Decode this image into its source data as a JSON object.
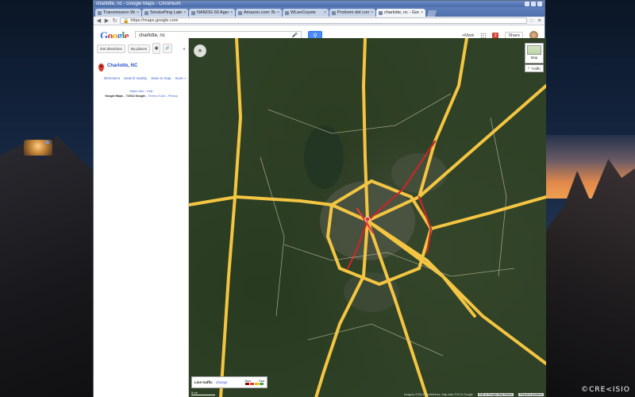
{
  "window": {
    "title": "charlotte, nc - Google Maps - Chromium"
  },
  "tabs": [
    {
      "label": "Transmission Web Inter",
      "active": false
    },
    {
      "label": "SmokePing Latency Pa",
      "active": false
    },
    {
      "label": "NANOG 60 Agenda | N",
      "active": false
    },
    {
      "label": "Amazon.com: Balance",
      "active": false
    },
    {
      "label": "WLeeCoyote",
      "active": false
    },
    {
      "label": "Proloom dot com: Unc",
      "active": false
    },
    {
      "label": "charlotte, nc - Google",
      "active": true
    }
  ],
  "toolbar": {
    "back_icon": "back-arrow-icon",
    "forward_icon": "forward-arrow-icon",
    "reload_icon": "reload-icon",
    "url": "https://maps.google.com"
  },
  "google_header": {
    "logo_letters": [
      "G",
      "o",
      "o",
      "g",
      "l",
      "e"
    ],
    "search_value": "charlotte, nc",
    "user_label": "+Mark",
    "notif_count": "2",
    "share_label": "Share"
  },
  "left_panel": {
    "get_directions_label": "Get directions",
    "my_places_label": "My places",
    "print_label": "🖶",
    "link_icon_label": "🔗",
    "result": {
      "title": "Charlotte, NC",
      "links": [
        "Directions",
        "Search nearby",
        "Save to map",
        "more »"
      ]
    },
    "footer": {
      "line1_a": "Maps Labs",
      "line1_b": "Help",
      "line2_a": "Google Maps",
      "line2_b": "©2014 Google",
      "line2_c": "Terms of Use",
      "line2_d": "Privacy"
    }
  },
  "map": {
    "layer_button_label": "Map",
    "traffic_button_label": "Traffic",
    "legend_title": "Live traffic",
    "legend_change": "change",
    "legend_slow": "Slow",
    "legend_fast": "Fast",
    "legend_colors": [
      "#8b0000",
      "#e53935",
      "#ffb300",
      "#43a047"
    ],
    "scale_label": "5 mi",
    "attribution": "Imagery ©2014 TerraMetrics, Map data ©2014 Google",
    "edit_label": "Edit in Google Map Maker",
    "report_label": "Report a problem"
  },
  "desktop": {
    "watermark": "©CRE<ISIO"
  }
}
